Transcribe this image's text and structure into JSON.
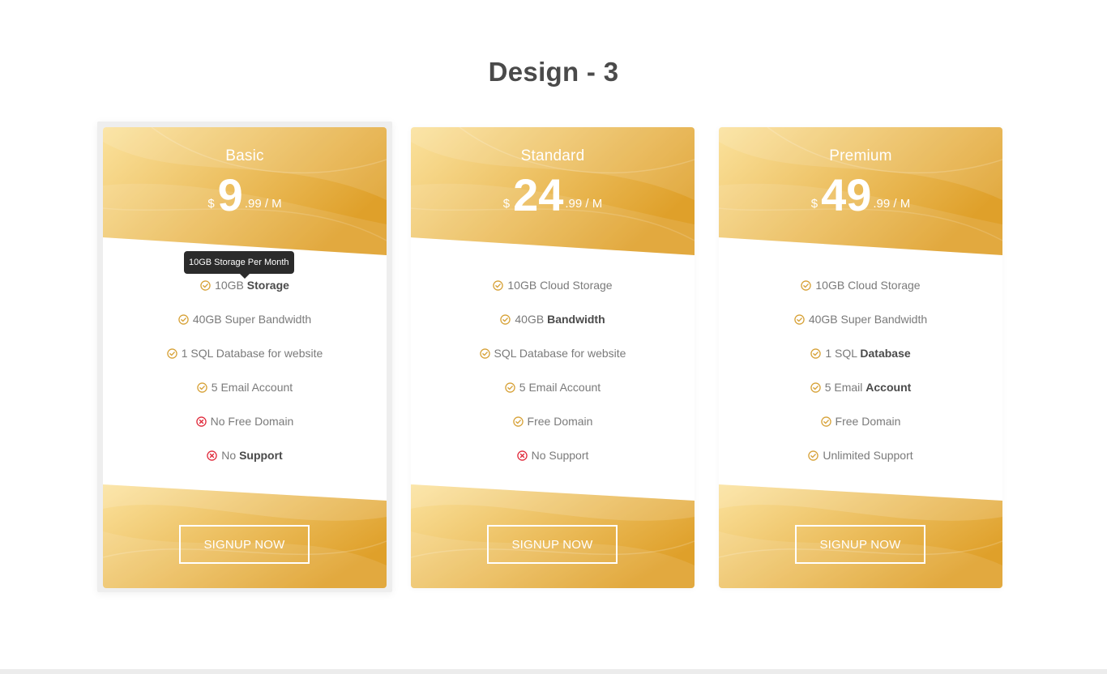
{
  "page": {
    "title": "Design - 3"
  },
  "colors": {
    "gold_light": "#fbe29d",
    "gold_dark": "#dfa02a",
    "check": "#d7a238",
    "cross": "#e02b3c"
  },
  "plans": [
    {
      "name": "Basic",
      "currency": "$",
      "price": "9",
      "cents": ".99 / M",
      "features": [
        {
          "icon": "check-icon",
          "pre": "10GB ",
          "bold": "Storage",
          "post": ""
        },
        {
          "icon": "check-icon",
          "pre": "40GB Super Bandwidth",
          "bold": "",
          "post": ""
        },
        {
          "icon": "check-icon",
          "pre": "1 SQL Database for website",
          "bold": "",
          "post": ""
        },
        {
          "icon": "check-icon",
          "pre": "5 Email Account",
          "bold": "",
          "post": ""
        },
        {
          "icon": "cross-icon",
          "pre": "No Free Domain",
          "bold": "",
          "post": ""
        },
        {
          "icon": "cross-icon",
          "pre": "No ",
          "bold": "Support",
          "post": ""
        }
      ],
      "button": "SIGNUP NOW",
      "tooltip": "10GB Storage Per Month"
    },
    {
      "name": "Standard",
      "currency": "$",
      "price": "24",
      "cents": ".99 / M",
      "features": [
        {
          "icon": "check-icon",
          "pre": "10GB Cloud Storage",
          "bold": "",
          "post": ""
        },
        {
          "icon": "check-icon",
          "pre": "40GB ",
          "bold": "Bandwidth",
          "post": ""
        },
        {
          "icon": "check-icon",
          "pre": "SQL Database for website",
          "bold": "",
          "post": ""
        },
        {
          "icon": "check-icon",
          "pre": "5 Email Account",
          "bold": "",
          "post": ""
        },
        {
          "icon": "check-icon",
          "pre": "Free Domain",
          "bold": "",
          "post": ""
        },
        {
          "icon": "cross-icon",
          "pre": "No Support",
          "bold": "",
          "post": ""
        }
      ],
      "button": "SIGNUP NOW"
    },
    {
      "name": "Premium",
      "currency": "$",
      "price": "49",
      "cents": ".99 / M",
      "features": [
        {
          "icon": "check-icon",
          "pre": "10GB Cloud Storage",
          "bold": "",
          "post": ""
        },
        {
          "icon": "check-icon",
          "pre": "40GB Super Bandwidth",
          "bold": "",
          "post": ""
        },
        {
          "icon": "check-icon",
          "pre": "1 SQL ",
          "bold": "Database",
          "post": ""
        },
        {
          "icon": "check-icon",
          "pre": "5 Email ",
          "bold": "Account",
          "post": ""
        },
        {
          "icon": "check-icon",
          "pre": "Free Domain",
          "bold": "",
          "post": ""
        },
        {
          "icon": "check-icon",
          "pre": "Unlimited Support",
          "bold": "",
          "post": ""
        }
      ],
      "button": "SIGNUP NOW"
    }
  ]
}
